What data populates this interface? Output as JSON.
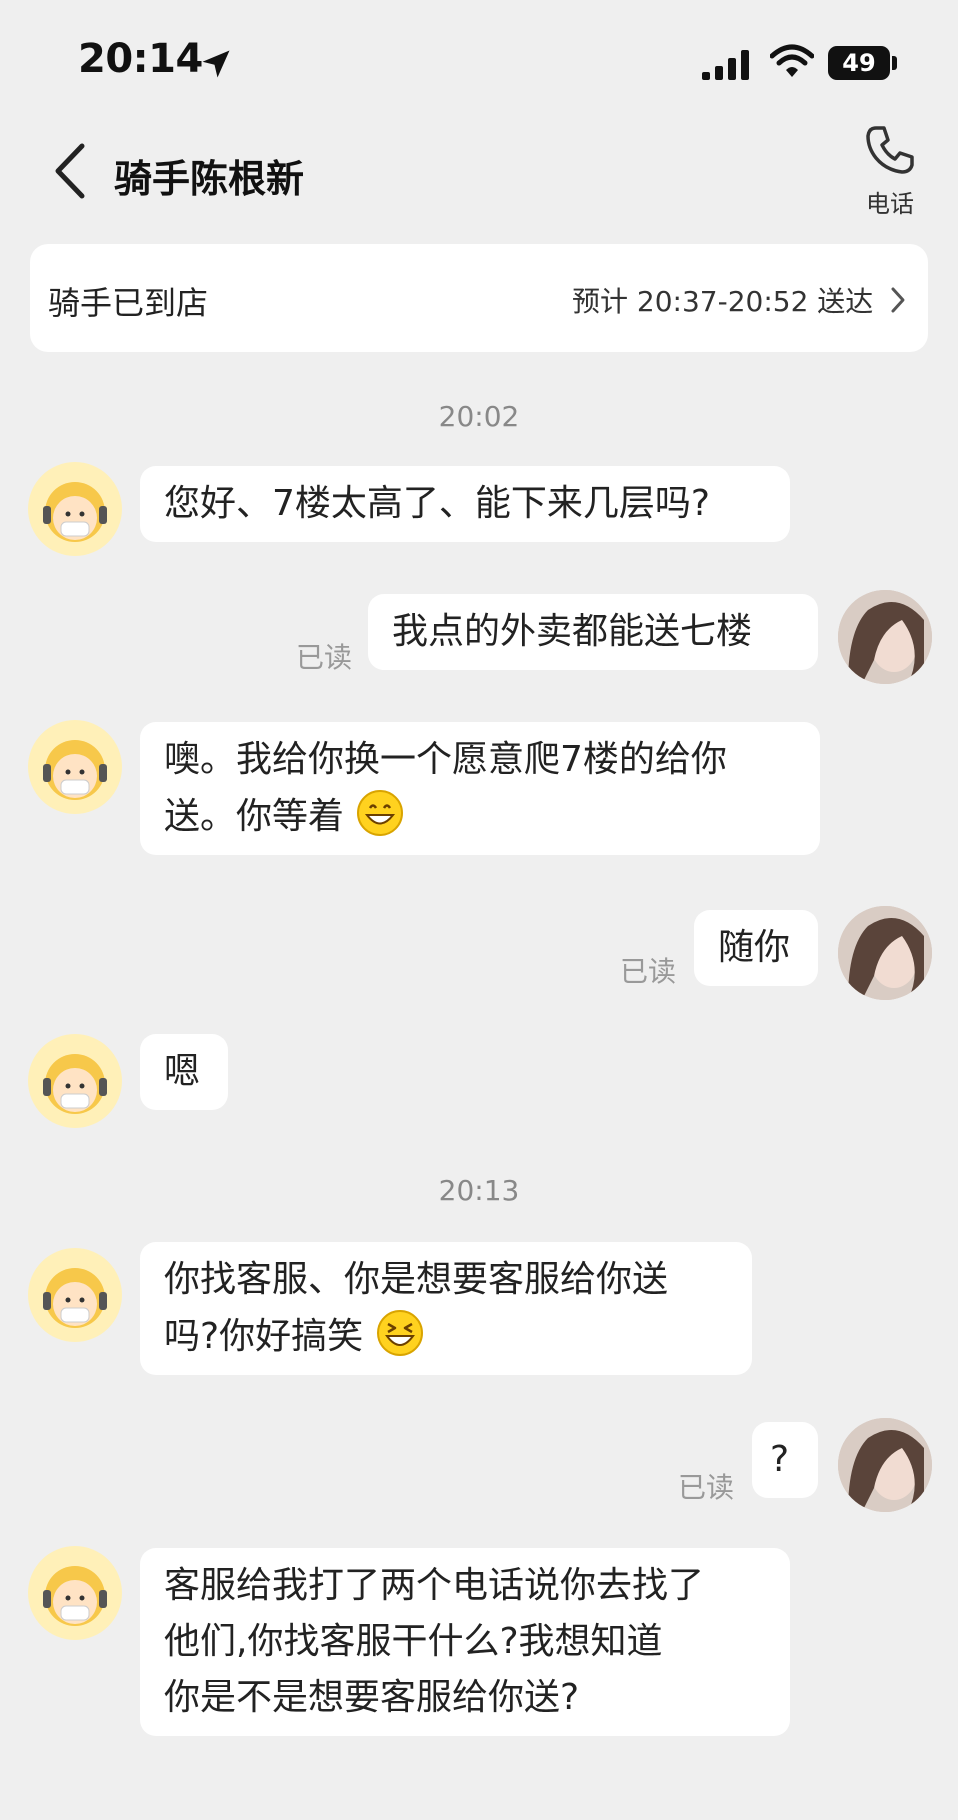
{
  "status_bar": {
    "time": "20:14",
    "battery": "49"
  },
  "header": {
    "title": "骑手陈根新",
    "phone_label": "电话"
  },
  "status_card": {
    "status": "骑手已到店",
    "eta": "预计 20:37-20:52 送达"
  },
  "timestamps": [
    "20:02",
    "20:13"
  ],
  "messages": [
    {
      "sender": "rider",
      "lines": [
        "您好、7楼太高了、能下来几层吗?"
      ]
    },
    {
      "sender": "me",
      "lines": [
        "我点的外卖都能送七楼"
      ],
      "read": "已读"
    },
    {
      "sender": "rider",
      "lines": [
        "噢。我给你换一个愿意爬7楼的给你",
        "送。你等着"
      ],
      "emoji": "grin-emoji"
    },
    {
      "sender": "me",
      "lines": [
        "随你"
      ],
      "read": "已读"
    },
    {
      "sender": "rider",
      "lines": [
        "嗯"
      ]
    },
    {
      "sender": "rider",
      "lines": [
        "你找客服、你是想要客服给你送",
        "吗?你好搞笑"
      ],
      "emoji": "laugh-emoji"
    },
    {
      "sender": "me",
      "lines": [
        "?"
      ],
      "read": "已读"
    },
    {
      "sender": "rider",
      "lines": [
        "客服给我打了两个电话说你去找了",
        "他们,你找客服干什么?我想知道",
        "你是不是想要客服给你送?"
      ]
    }
  ],
  "colors": {
    "background": "#efefef",
    "bubble": "#ffffff",
    "rider_avatar": "#fff0b8"
  }
}
